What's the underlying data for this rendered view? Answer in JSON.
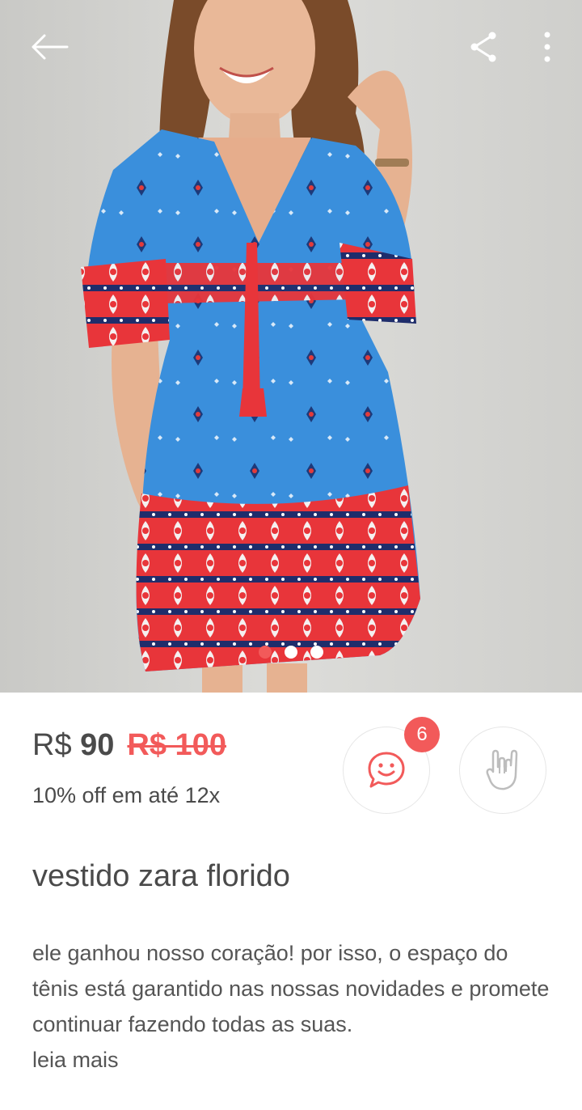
{
  "navigation": {
    "back_icon": "arrow-left-icon",
    "share_icon": "share-icon",
    "more_icon": "more-vertical-icon"
  },
  "gallery": {
    "image_count": 3,
    "active_index": 0,
    "active_color": "#f25a5a"
  },
  "product": {
    "currency": "R$",
    "price": "90",
    "original_price": "R$ 100",
    "installments": "10% off em até 12x",
    "title": "vestido zara florido",
    "description": "ele ganhou nosso coração! por isso, o espaço do tênis está garantido nas nossas novidades e promete continuar fazendo todas as suas.",
    "read_more": "leia mais"
  },
  "actions": {
    "chat_icon": "chat-smile-icon",
    "chat_badge": "6",
    "rock_icon": "rock-hand-icon"
  },
  "colors": {
    "accent": "#f25a5a",
    "text": "#4a4a4a"
  }
}
